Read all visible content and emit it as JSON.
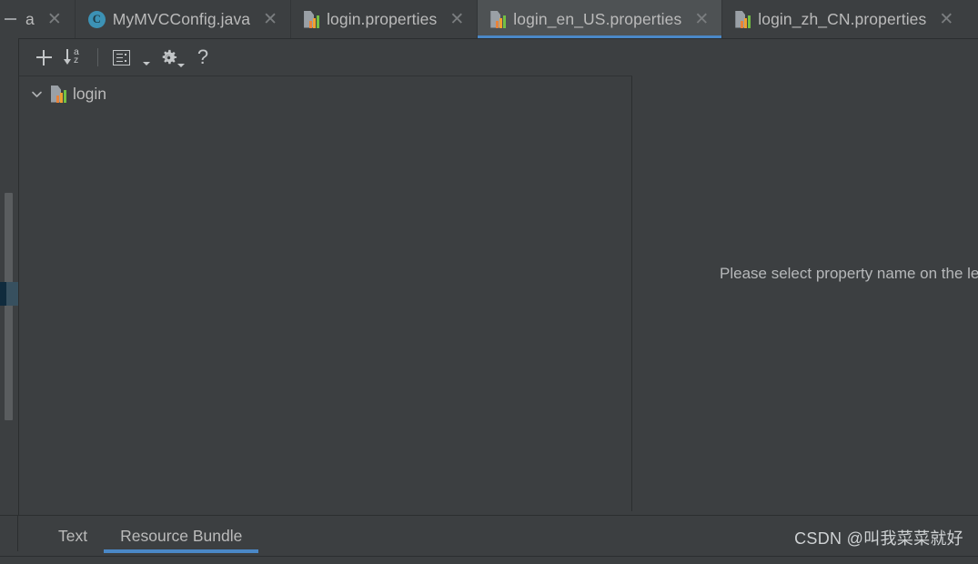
{
  "theme": {
    "background": "#3c3f41",
    "tab_active_background": "#4e5254",
    "accent": "#4a88c7",
    "text": "#bbbbbb",
    "border": "#2b2e2f",
    "scrollbar_thumb": "#5a5d5f",
    "marker_highlight": "#37505f"
  },
  "editor_tabs": [
    {
      "label": "a",
      "icon": "truncated-tab",
      "active": false,
      "close_icon": "close-icon",
      "clipped": true
    },
    {
      "label": "MyMVCConfig.java",
      "icon": "java-class-icon",
      "icon_letter": "C",
      "active": false,
      "close_icon": "close-icon",
      "clipped": false
    },
    {
      "label": "login.properties",
      "icon": "properties-file-icon",
      "active": false,
      "close_icon": "close-icon",
      "clipped": false
    },
    {
      "label": "login_en_US.properties",
      "icon": "properties-file-icon",
      "active": true,
      "close_icon": "close-icon",
      "clipped": false
    },
    {
      "label": "login_zh_CN.properties",
      "icon": "properties-file-icon",
      "active": false,
      "close_icon": "close-icon",
      "clipped": false
    }
  ],
  "toolbar": {
    "add_label": "+",
    "add_icon": "plus-icon",
    "sort_icon": "sort-alphabetical-icon",
    "sort_letter_top": "a",
    "sort_letter_bottom": "z",
    "group_icon": "group-by-icon",
    "group_dropdown_icon": "chevron-down-icon",
    "settings_icon": "gear-icon",
    "settings_dropdown_icon": "chevron-down-icon",
    "help_icon": "question-mark-icon",
    "help_label": "?"
  },
  "tree": {
    "expand_icon": "chevron-down-icon",
    "nodes": [
      {
        "label": "login",
        "icon": "properties-file-icon",
        "expanded": true
      }
    ]
  },
  "detail_panel": {
    "message": "Please select property name on the left"
  },
  "bottom_tabs": [
    {
      "label": "Text",
      "active": false
    },
    {
      "label": "Resource Bundle",
      "active": true
    }
  ],
  "watermark": {
    "text": "CSDN @叫我菜菜就好"
  }
}
